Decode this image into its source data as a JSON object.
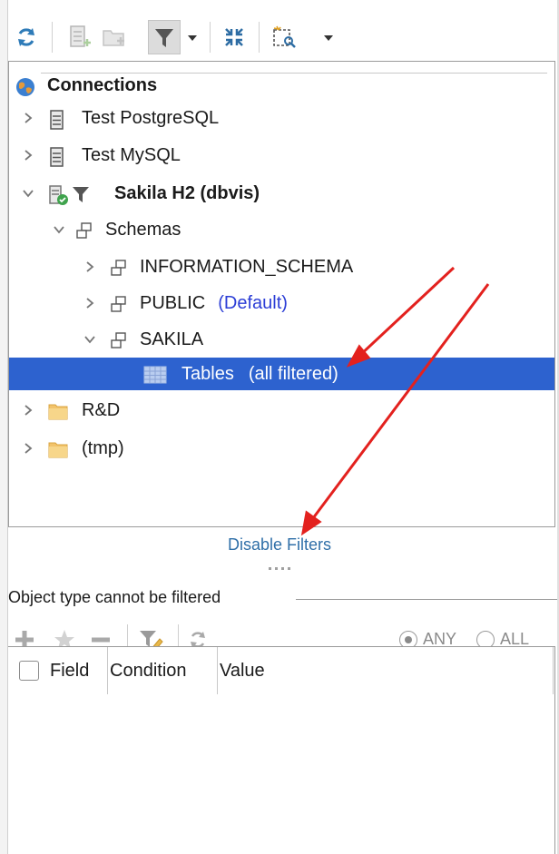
{
  "toolbar": {
    "buttons": [
      {
        "name": "refresh-icon"
      },
      {
        "name": "add-connection-icon"
      },
      {
        "name": "add-folder-icon"
      },
      {
        "name": "filter-icon"
      },
      {
        "name": "filter-dropdown-chevron-icon"
      },
      {
        "name": "collapse-all-icon"
      },
      {
        "name": "object-view-icon"
      },
      {
        "name": "object-view-dropdown-chevron-icon"
      }
    ]
  },
  "tree": {
    "root_label": "Connections",
    "items": [
      {
        "label": "Test PostgreSQL"
      },
      {
        "label": "Test MySQL"
      },
      {
        "label": "Sakila H2 (dbvis)"
      },
      {
        "label": "Schemas"
      },
      {
        "label": "INFORMATION_SCHEMA"
      },
      {
        "label": "PUBLIC",
        "suffix": "(Default)"
      },
      {
        "label": "SAKILA"
      },
      {
        "label": "Tables",
        "suffix": "(all filtered)"
      },
      {
        "label": "R&D"
      },
      {
        "label": "(tmp)"
      }
    ],
    "colors": {
      "selection": "#2d62cf",
      "default_suffix": "#2c3ed6"
    }
  },
  "disable_filters_link": "Disable Filters",
  "filter_panel": {
    "group_label": "Object type cannot be filtered",
    "radio_any": "ANY",
    "radio_all": "ALL",
    "radio_selected": "ANY",
    "table_headers": [
      "Field",
      "Condition",
      "Value"
    ]
  },
  "annotation": {
    "arrow_color": "#e3211e"
  }
}
